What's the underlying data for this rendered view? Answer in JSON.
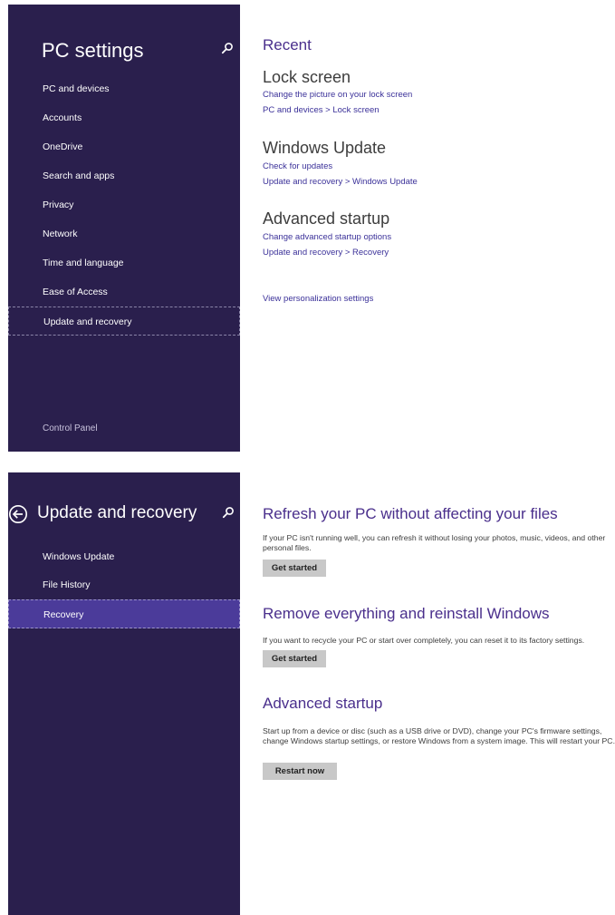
{
  "screen1": {
    "sidebar": {
      "title": "PC settings",
      "items": [
        {
          "label": "PC and devices"
        },
        {
          "label": "Accounts"
        },
        {
          "label": "OneDrive"
        },
        {
          "label": "Search and apps"
        },
        {
          "label": "Privacy"
        },
        {
          "label": "Network"
        },
        {
          "label": "Time and language"
        },
        {
          "label": "Ease of Access"
        },
        {
          "label": "Update and recovery"
        }
      ],
      "footer": "Control Panel"
    },
    "main": {
      "recent_heading": "Recent",
      "groups": [
        {
          "title": "Lock screen",
          "links": [
            "Change the picture on your lock screen",
            "PC and devices > Lock screen"
          ]
        },
        {
          "title": "Windows Update",
          "links": [
            "Check for updates",
            "Update and recovery > Windows Update"
          ]
        },
        {
          "title": "Advanced startup",
          "links": [
            "Change advanced startup options",
            "Update and recovery > Recovery"
          ]
        }
      ],
      "personalization_link": "View personalization settings"
    }
  },
  "screen2": {
    "sidebar": {
      "title": "Update and recovery",
      "items": [
        {
          "label": "Windows Update"
        },
        {
          "label": "File History"
        },
        {
          "label": "Recovery"
        }
      ]
    },
    "main": {
      "sections": [
        {
          "title": "Refresh your PC without affecting your files",
          "description": "If your PC isn't running well, you can refresh it without losing your photos, music, videos, and other personal files.",
          "button": "Get started"
        },
        {
          "title": "Remove everything and reinstall Windows",
          "description": "If you want to recycle your PC or start over completely, you can reset it to its factory settings.",
          "button": "Get started"
        },
        {
          "title": "Advanced startup",
          "description": "Start up from a device or disc (such as a USB drive or DVD), change your PC's firmware settings, change Windows startup settings, or restore Windows from a system image. This will restart your PC.",
          "button": "Restart now"
        }
      ]
    }
  },
  "colors": {
    "sidebar_bg": "#2a1f4d",
    "selected_bg": "#4b3b9a",
    "accent": "#4a2f8c",
    "link": "#3b3199",
    "button_bg": "#c8c8c8"
  },
  "icons": [
    "search-icon",
    "back-arrow-icon"
  ]
}
